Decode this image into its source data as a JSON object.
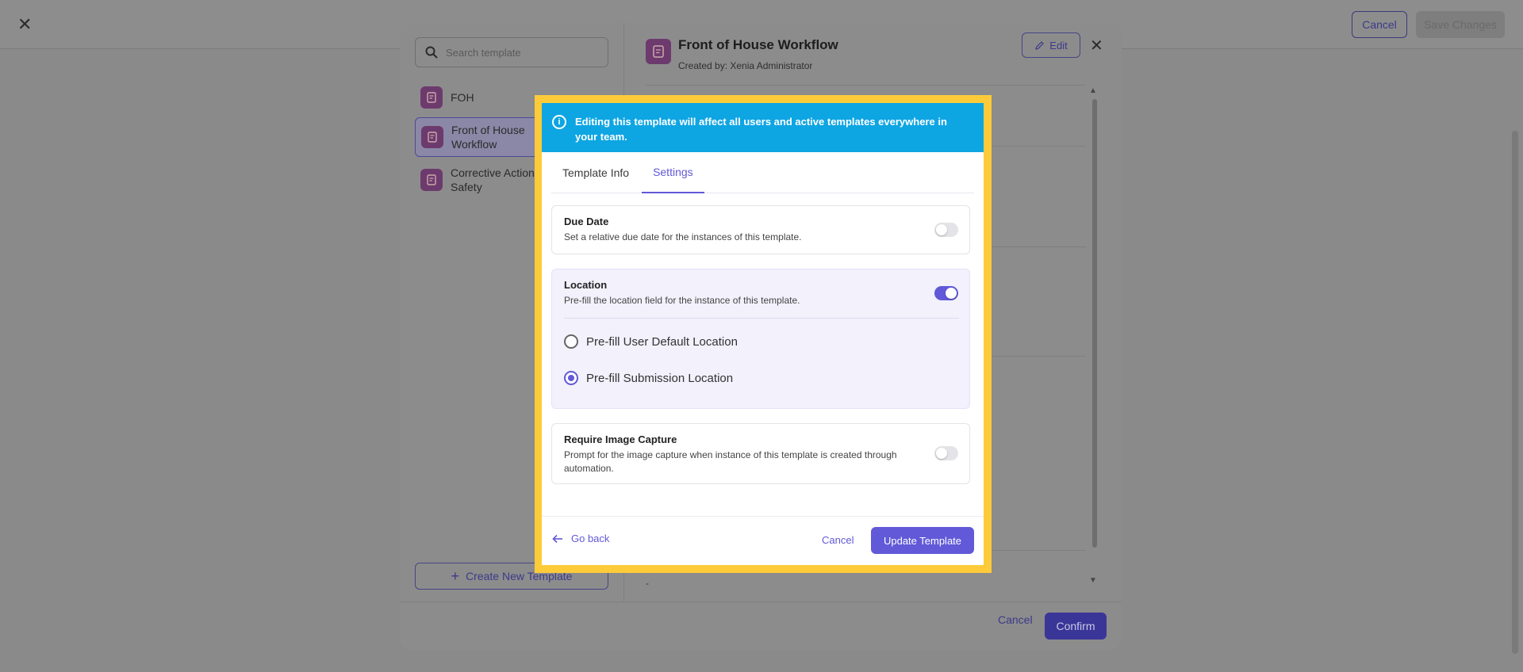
{
  "topbar": {
    "close": "✕",
    "cancel": "Cancel",
    "save": "Save Changes"
  },
  "outer": {
    "search_placeholder": "Search template",
    "templates": [
      {
        "label": "FOH"
      },
      {
        "label": "Front of House Workflow"
      },
      {
        "label": "Corrective Action Safety"
      }
    ],
    "create_button": "Create New Template",
    "header": {
      "title": "Front of House Workflow",
      "created_by": "Created by: Xenia Administrator"
    },
    "edit": "Edit",
    "close": "✕",
    "footer": {
      "cancel": "Cancel",
      "confirm": "Confirm"
    },
    "obscured_dash": "-"
  },
  "dialog": {
    "banner": "Editing this template will affect all users and active templates everywhere in your team.",
    "tabs": [
      {
        "label": "Template Info"
      },
      {
        "label": "Settings"
      }
    ],
    "active_tab": "Settings",
    "due_date": {
      "title": "Due Date",
      "desc": "Set a relative due date for the instances of this template.",
      "enabled": false
    },
    "location": {
      "title": "Location",
      "desc": "Pre-fill the location field for the instance of this template.",
      "enabled": true,
      "options": [
        {
          "label": "Pre-fill User Default Location"
        },
        {
          "label": "Pre-fill Submission Location"
        }
      ],
      "selected": "Pre-fill Submission Location"
    },
    "image_capture": {
      "title": "Require Image Capture",
      "desc": "Prompt for the image capture when instance of this template is created through automation.",
      "enabled": false
    },
    "footer": {
      "go_back": "Go back",
      "cancel": "Cancel",
      "update": "Update Template"
    }
  },
  "colors": {
    "accent": "#6159d8",
    "banner": "#0ea5e3",
    "highlight": "#fdcb3a"
  }
}
